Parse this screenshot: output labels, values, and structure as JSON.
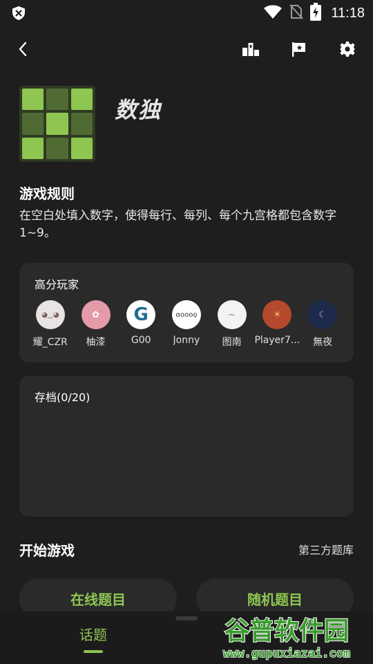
{
  "status_bar": {
    "time": "11:18",
    "icons": [
      "shield-x-icon",
      "wifi-icon",
      "no-sim-icon",
      "battery-charging-icon"
    ]
  },
  "app_bar": {
    "icons": [
      "back-arrow-icon",
      "leaderboard-icon",
      "flag-icon",
      "settings-icon"
    ]
  },
  "game": {
    "title": "数独",
    "logo_pattern": [
      1,
      0,
      1,
      0,
      1,
      0,
      1,
      0,
      1
    ],
    "colors": {
      "accent": "#8fc651",
      "dark_cell": "#506a34"
    }
  },
  "rules": {
    "heading": "游戏规则",
    "text": "在空白处填入数字，使得每行、每列、每个九宫格都包含数字1~9。"
  },
  "top_players": {
    "title": "高分玩家",
    "players": [
      {
        "name": "耀_CZR",
        "avatar_glyph": "◕‿◕",
        "avatar_bg": "#e8e4e4",
        "avatar_fg": "#7a5c5c"
      },
      {
        "name": "柚漆",
        "avatar_glyph": "✿",
        "avatar_bg": "#e49aa8",
        "avatar_fg": "#ffffff"
      },
      {
        "name": "G00",
        "avatar_glyph": "G",
        "avatar_bg": "#ffffff",
        "avatar_fg": "#1d6f8e"
      },
      {
        "name": "Jonny",
        "avatar_glyph": "ɞoooọ",
        "avatar_bg": "#ffffff",
        "avatar_fg": "#333333"
      },
      {
        "name": "图南",
        "avatar_glyph": "~",
        "avatar_bg": "#f3f3f3",
        "avatar_fg": "#888888"
      },
      {
        "name": "Player7...",
        "avatar_glyph": "☀",
        "avatar_bg": "#b5492c",
        "avatar_fg": "#f6c06a"
      },
      {
        "name": "無夜",
        "avatar_glyph": "☾",
        "avatar_bg": "#1d2a4c",
        "avatar_fg": "#9bb1e6"
      }
    ]
  },
  "saves": {
    "title": "存档(0/20)"
  },
  "start": {
    "heading": "开始游戏",
    "third_party_link": "第三方题库",
    "online_button": "在线题目",
    "random_button": "随机题目"
  },
  "bottom_nav": {
    "topic_tab": "话题"
  },
  "watermark": {
    "title": "谷普软件园",
    "url": "www.gupuxiazai.com"
  }
}
